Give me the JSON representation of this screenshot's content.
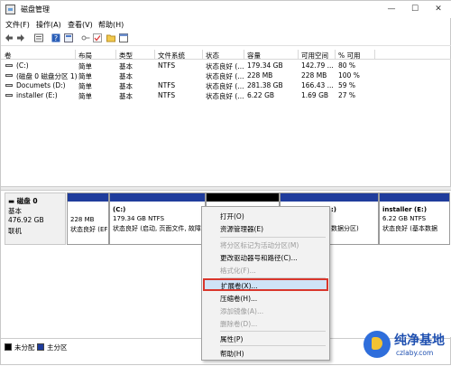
{
  "window": {
    "title": "磁盘管理",
    "minimize": "—",
    "maximize": "☐",
    "close": "✕"
  },
  "menu": [
    "文件(F)",
    "操作(A)",
    "查看(V)",
    "帮助(H)"
  ],
  "toolbar_icons": [
    "back-arrow-icon",
    "forward-arrow-icon",
    "list-view-icon",
    "help-icon",
    "properties-icon",
    "key-icon",
    "check-icon",
    "folder-icon",
    "window-icon"
  ],
  "table": {
    "headers": [
      "卷",
      "布局",
      "类型",
      "文件系统",
      "状态",
      "容量",
      "可用空间",
      "% 可用"
    ],
    "rows": [
      {
        "volume": "(C:)",
        "layout": "简单",
        "type": "基本",
        "fs": "NTFS",
        "status": "状态良好 (...",
        "capacity": "179.34 GB",
        "free": "142.79 ...",
        "pct": "80 %"
      },
      {
        "volume": "(磁盘 0 磁盘分区 1)",
        "layout": "简单",
        "type": "基本",
        "fs": "",
        "status": "状态良好 (...",
        "capacity": "228 MB",
        "free": "228 MB",
        "pct": "100 %"
      },
      {
        "volume": "Documets (D:)",
        "layout": "简单",
        "type": "基本",
        "fs": "NTFS",
        "status": "状态良好 (...",
        "capacity": "281.38 GB",
        "free": "166.43 ...",
        "pct": "59 %"
      },
      {
        "volume": "installer (E:)",
        "layout": "简单",
        "type": "基本",
        "fs": "NTFS",
        "status": "状态良好 (...",
        "capacity": "6.22 GB",
        "free": "1.69 GB",
        "pct": "27 %"
      }
    ]
  },
  "disk": {
    "name": "磁盘 0",
    "type": "基本",
    "size": "476.92 GB",
    "state": "联机"
  },
  "partitions": [
    {
      "name": "",
      "size": "228 MB",
      "status": "状态良好 (EF"
    },
    {
      "name": "(C:)",
      "size": "179.34 GB NTFS",
      "status": "状态良好 (启动, 页面文件, 故障"
    },
    {
      "name": ":)",
      "size": "",
      "status": "数据分区)"
    },
    {
      "name": "installer  (E:)",
      "size": "6.22 GB NTFS",
      "status": "状态良好 (基本数据"
    }
  ],
  "legend": [
    "未分配",
    "主分区"
  ],
  "context_menu": {
    "items": [
      {
        "label": "打开(O)",
        "disabled": false
      },
      {
        "label": "资源管理器(E)",
        "disabled": false
      },
      {
        "label": "将分区标记为活动分区(M)",
        "disabled": true
      },
      {
        "label": "更改驱动器号和路径(C)...",
        "disabled": false
      },
      {
        "label": "格式化(F)...",
        "disabled": true
      },
      {
        "label": "扩展卷(X)...",
        "disabled": false,
        "highlighted": true
      },
      {
        "label": "压缩卷(H)...",
        "disabled": false
      },
      {
        "label": "添加镜像(A)...",
        "disabled": true
      },
      {
        "label": "删除卷(D)...",
        "disabled": true
      },
      {
        "label": "属性(P)",
        "disabled": false
      },
      {
        "label": "帮助(H)",
        "disabled": false
      }
    ]
  },
  "watermark": {
    "text": "纯净基地",
    "url": "czlaby.com"
  },
  "colors": {
    "primary_partition_bar": "#1f3c9c",
    "unallocated": "#000000",
    "highlight_fill": "#cfe3f7",
    "highlight_border": "#d9362c"
  }
}
